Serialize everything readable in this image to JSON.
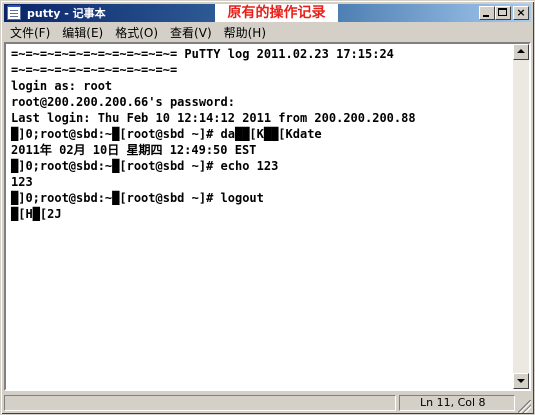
{
  "window": {
    "title": "putty - 记事本",
    "annotation": "原有的操作记录"
  },
  "menu": [
    {
      "label": "文件(F)"
    },
    {
      "label": "编辑(E)"
    },
    {
      "label": "格式(O)"
    },
    {
      "label": "查看(V)"
    },
    {
      "label": "帮助(H)"
    }
  ],
  "content": {
    "lines": [
      "=~=~=~=~=~=~=~=~=~=~=~= PuTTY log 2011.02.23 17:15:24",
      "=~=~=~=~=~=~=~=~=~=~=~=",
      "login as: root",
      "root@200.200.200.66's password:",
      "Last login: Thu Feb 10 12:14:12 2011 from 200.200.200.88",
      "█]0;root@sbd:~█[root@sbd ~]# da██[K██[Kdate",
      "2011年 02月 10日 星期四 12:49:50 EST",
      "█]0;root@sbd:~█[root@sbd ~]# echo 123",
      "123",
      "█]0;root@sbd:~█[root@sbd ~]# logout",
      "█[H█[2J"
    ]
  },
  "status": {
    "position": "Ln 11, Col 8"
  },
  "colors": {
    "title_gradient_start": "#0a246a",
    "title_gradient_end": "#a6caf0",
    "annotation_text": "#e8201a",
    "chrome": "#d4d0c8"
  },
  "icons": {
    "app": "notepad-icon",
    "minimize": "minimize-icon",
    "maximize": "maximize-icon",
    "close": "close-icon",
    "scroll_up": "arrow-up-icon",
    "scroll_down": "arrow-down-icon",
    "grip": "resize-grip-icon"
  }
}
